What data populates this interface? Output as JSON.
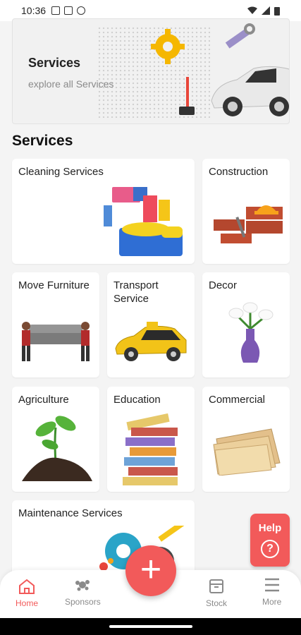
{
  "statusbar": {
    "time": "10:36"
  },
  "banner": {
    "title": "Services",
    "subtitle": "explore all Services"
  },
  "section_title": "Services",
  "services": {
    "cleaning": "Cleaning Services",
    "construction": "Construction",
    "move": "Move Furniture",
    "transport": "Transport Service",
    "decor": "Decor",
    "agriculture": "Agriculture",
    "education": "Education",
    "commercial": "Commercial",
    "maintenance": "Maintenance Services"
  },
  "help": {
    "label": "Help",
    "icon": "?"
  },
  "nav": {
    "home": "Home",
    "sponsors": "Sponsors",
    "stock": "Stock",
    "more": "More"
  },
  "colors": {
    "accent": "#f25a5a"
  }
}
